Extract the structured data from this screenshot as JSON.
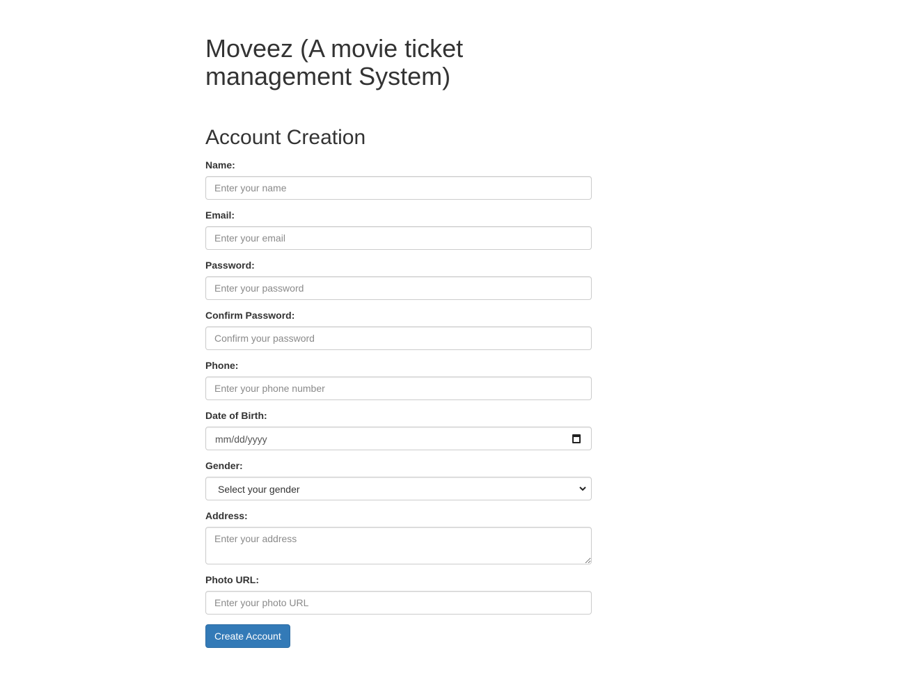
{
  "header": {
    "app_title": "Moveez (A movie ticket management System)",
    "form_title": "Account Creation"
  },
  "form": {
    "name": {
      "label": "Name:",
      "placeholder": "Enter your name",
      "value": ""
    },
    "email": {
      "label": "Email:",
      "placeholder": "Enter your email",
      "value": ""
    },
    "password": {
      "label": "Password:",
      "placeholder": "Enter your password",
      "value": ""
    },
    "confirm_password": {
      "label": "Confirm Password:",
      "placeholder": "Confirm your password",
      "value": ""
    },
    "phone": {
      "label": "Phone:",
      "placeholder": "Enter your phone number",
      "value": ""
    },
    "dob": {
      "label": "Date of Birth:",
      "display": "mm/dd/yyyy",
      "icon": "calendar-icon"
    },
    "gender": {
      "label": "Gender:",
      "selected": "Select your gender",
      "icon": "chevron-down-icon"
    },
    "address": {
      "label": "Address:",
      "placeholder": "Enter your address",
      "value": ""
    },
    "photo_url": {
      "label": "Photo URL:",
      "placeholder": "Enter your photo URL",
      "value": ""
    },
    "submit_label": "Create Account"
  },
  "colors": {
    "primary_button": "#337ab7",
    "primary_button_border": "#2e6da4",
    "text": "#333333",
    "input_border": "#cccccc"
  }
}
